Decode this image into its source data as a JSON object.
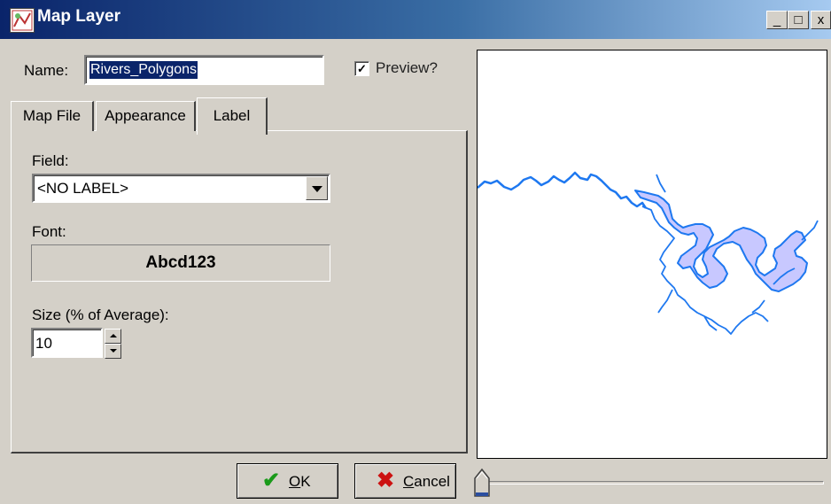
{
  "window": {
    "title": "Map Layer",
    "controls": {
      "minimize": "_",
      "maximize": "□",
      "close": "x"
    }
  },
  "name_field": {
    "label": "Name:",
    "value": "Rivers_Polygons"
  },
  "preview_checkbox": {
    "label": "Preview?",
    "checked": true
  },
  "tabs": [
    {
      "label": "Map File",
      "active": false
    },
    {
      "label": "Appearance",
      "active": false
    },
    {
      "label": "Label",
      "active": true
    }
  ],
  "label_tab": {
    "field_label": "Field:",
    "field_value": "<NO LABEL>",
    "font_label": "Font:",
    "font_sample": "Abcd123",
    "size_label": "Size (% of Average):",
    "size_value": "10"
  },
  "buttons": {
    "ok": {
      "label_underlined": "O",
      "label_rest": "K",
      "icon": "checkmark-icon"
    },
    "cancel": {
      "label_underlined": "C",
      "label_rest": "ancel",
      "icon": "x-icon"
    }
  },
  "colors": {
    "river_outline": "#1e78f0",
    "river_fill": "#c8c8ff",
    "title_gradient_start": "#0a246a",
    "title_gradient_end": "#a6caf0",
    "ok_check": "#1a9a1a",
    "cancel_x": "#cc1111"
  },
  "slider": {
    "position": 0
  }
}
